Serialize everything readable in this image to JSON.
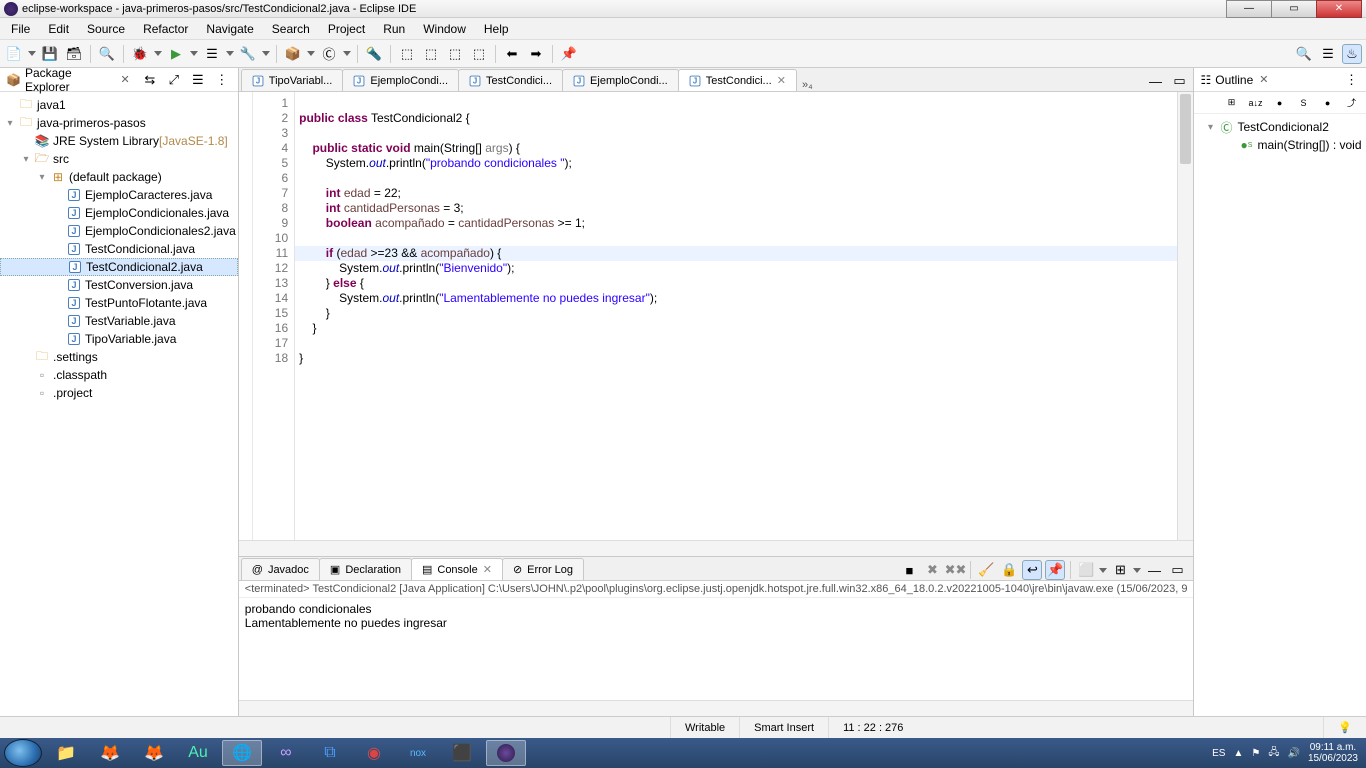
{
  "window_title": "eclipse-workspace - java-primeros-pasos/src/TestCondicional2.java - Eclipse IDE",
  "menus": [
    "File",
    "Edit",
    "Source",
    "Refactor",
    "Navigate",
    "Search",
    "Project",
    "Run",
    "Window",
    "Help"
  ],
  "package_explorer": {
    "title": "Package Explorer",
    "roots": [
      {
        "label": "java1",
        "type": "project",
        "expanded": false
      },
      {
        "label": "java-primeros-pasos",
        "type": "project",
        "expanded": true,
        "children": [
          {
            "label": "JRE System Library",
            "extra": "[JavaSE-1.8]",
            "type": "jre",
            "expanded": false
          },
          {
            "label": "src",
            "type": "srcfolder",
            "expanded": true,
            "children": [
              {
                "label": "(default package)",
                "type": "package",
                "expanded": true,
                "children": [
                  {
                    "label": "EjemploCaracteres.java",
                    "type": "java"
                  },
                  {
                    "label": "EjemploCondicionales.java",
                    "type": "java"
                  },
                  {
                    "label": "EjemploCondicionales2.java",
                    "type": "java"
                  },
                  {
                    "label": "TestCondicional.java",
                    "type": "java"
                  },
                  {
                    "label": "TestCondicional2.java",
                    "type": "java",
                    "selected": true
                  },
                  {
                    "label": "TestConversion.java",
                    "type": "java"
                  },
                  {
                    "label": "TestPuntoFlotante.java",
                    "type": "java"
                  },
                  {
                    "label": "TestVariable.java",
                    "type": "java"
                  },
                  {
                    "label": "TipoVariable.java",
                    "type": "java"
                  }
                ]
              }
            ]
          },
          {
            "label": ".settings",
            "type": "folder",
            "expanded": false
          },
          {
            "label": ".classpath",
            "type": "file"
          },
          {
            "label": ".project",
            "type": "file"
          }
        ]
      }
    ]
  },
  "editor_tabs": [
    {
      "label": "TipoVariabl...",
      "active": false
    },
    {
      "label": "EjemploCondi...",
      "active": false
    },
    {
      "label": "TestCondici...",
      "active": false
    },
    {
      "label": "EjemploCondi...",
      "active": false
    },
    {
      "label": "TestCondici...",
      "active": true
    }
  ],
  "extra_tabs_indicator": "»₄",
  "code_lines": [
    {
      "n": 1,
      "html": ""
    },
    {
      "n": 2,
      "html": "<span class='kw'>public</span> <span class='kw'>class</span> TestCondicional2 {"
    },
    {
      "n": 3,
      "html": ""
    },
    {
      "n": 4,
      "html": "    <span class='kw'>public</span> <span class='kw'>static</span> <span class='kw'>void</span> main(String[] <span class='arg'>args</span>) {",
      "marker": "▸"
    },
    {
      "n": 5,
      "html": "        System.<span class='field'>out</span>.println(<span class='str'>\"probando condicionales \"</span>);"
    },
    {
      "n": 6,
      "html": ""
    },
    {
      "n": 7,
      "html": "        <span class='kw'>int</span> <span class='var'>edad</span> = 22;"
    },
    {
      "n": 8,
      "html": "        <span class='kw'>int</span> <span class='var'>cantidadPersonas</span> = 3;"
    },
    {
      "n": 9,
      "html": "        <span class='kw'>boolean</span> <span class='var'>acompañado</span> = <span class='var'>cantidadPersonas</span> &gt;= 1;"
    },
    {
      "n": 10,
      "html": ""
    },
    {
      "n": 11,
      "html": "        <span class='kw'>if</span> (<span class='var'>edad</span> &gt;=23 && <span class='var'>acompañado</span>) {",
      "hl": true
    },
    {
      "n": 12,
      "html": "            System.<span class='field'>out</span>.println(<span class='str'>\"Bienvenido\"</span>);"
    },
    {
      "n": 13,
      "html": "        } <span class='kw'>else</span> {"
    },
    {
      "n": 14,
      "html": "            System.<span class='field'>out</span>.println(<span class='str'>\"Lamentablemente no puedes ingresar\"</span>);"
    },
    {
      "n": 15,
      "html": "        }"
    },
    {
      "n": 16,
      "html": "    }"
    },
    {
      "n": 17,
      "html": ""
    },
    {
      "n": 18,
      "html": "}"
    }
  ],
  "bottom_tabs": [
    {
      "label": "Javadoc",
      "icon": "@",
      "active": false
    },
    {
      "label": "Declaration",
      "icon": "▣",
      "active": false
    },
    {
      "label": "Console",
      "icon": "▤",
      "active": true
    },
    {
      "label": "Error Log",
      "icon": "⊘",
      "active": false
    }
  ],
  "console": {
    "header": "<terminated> TestCondicional2 [Java Application] C:\\Users\\JOHN\\.p2\\pool\\plugins\\org.eclipse.justj.openjdk.hotspot.jre.full.win32.x86_64_18.0.2.v20221005-1040\\jre\\bin\\javaw.exe (15/06/2023, 9",
    "lines": [
      "probando condicionales ",
      "Lamentablemente no puedes ingresar"
    ]
  },
  "outline": {
    "title": "Outline",
    "class": "TestCondicional2",
    "method": "main(String[]) : void"
  },
  "status": {
    "writable": "Writable",
    "insert": "Smart Insert",
    "pos": "11 : 22 : 276"
  },
  "tray": {
    "lang": "ES",
    "time": "09:11 a.m.",
    "date": "15/06/2023"
  }
}
